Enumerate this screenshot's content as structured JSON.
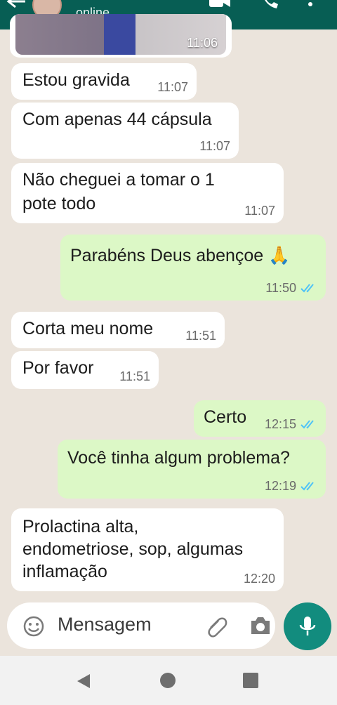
{
  "header": {
    "status": "online"
  },
  "image_message": {
    "time": "11:06"
  },
  "messages": [
    {
      "dir": "in",
      "text": "Estou gravida",
      "time": "11:07"
    },
    {
      "dir": "in",
      "text": "Com apenas 44 cápsula",
      "time": "11:07"
    },
    {
      "dir": "in",
      "line1": "Não cheguei a tomar o 1",
      "line2": "pote todo",
      "time": "11:07"
    },
    {
      "dir": "out",
      "text": "Parabéns Deus abençoe 🙏",
      "time": "11:50",
      "read": true
    },
    {
      "dir": "in",
      "text": "Corta meu nome",
      "time": "11:51"
    },
    {
      "dir": "in",
      "text": "Por favor",
      "time": "11:51"
    },
    {
      "dir": "out",
      "text": "Certo",
      "time": "12:15",
      "read": true
    },
    {
      "dir": "out",
      "text": "Você tinha algum problema?",
      "time": "12:19",
      "read": true
    },
    {
      "dir": "in",
      "line1": "Prolactina alta,",
      "line2": "endometriose, sop, algumas",
      "line3": "inflamação",
      "time": "12:20"
    }
  ],
  "composer": {
    "placeholder": "Mensagem"
  },
  "colors": {
    "header": "#075e54",
    "outgoing": "#dcf8c6",
    "incoming": "#ffffff",
    "mic_button": "#128c7e",
    "read_ticks": "#4fc3f7"
  },
  "icons": [
    "back-arrow-icon",
    "video-call-icon",
    "phone-icon",
    "more-icon",
    "emoji-icon",
    "attach-icon",
    "camera-icon",
    "mic-icon",
    "nav-back-icon",
    "nav-home-icon",
    "nav-recents-icon"
  ]
}
